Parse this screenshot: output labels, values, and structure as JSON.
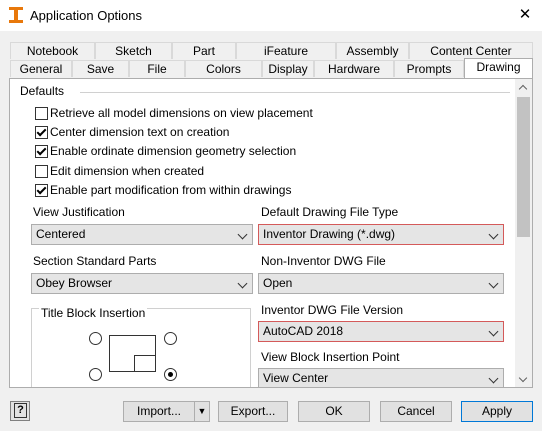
{
  "window": {
    "title": "Application Options",
    "close_glyph": "✕"
  },
  "tabs_row1": [
    {
      "label": "Notebook"
    },
    {
      "label": "Sketch"
    },
    {
      "label": "Part"
    },
    {
      "label": "iFeature"
    },
    {
      "label": "Assembly"
    },
    {
      "label": "Content Center"
    }
  ],
  "tabs_row2": [
    {
      "label": "General"
    },
    {
      "label": "Save"
    },
    {
      "label": "File"
    },
    {
      "label": "Colors"
    },
    {
      "label": "Display"
    },
    {
      "label": "Hardware"
    },
    {
      "label": "Prompts"
    },
    {
      "label": "Drawing"
    }
  ],
  "active_tab": "Drawing",
  "defaults": {
    "title": "Defaults",
    "checkboxes": [
      {
        "label": "Retrieve all model dimensions on view placement",
        "checked": false
      },
      {
        "label": "Center dimension text on creation",
        "checked": true
      },
      {
        "label": "Enable ordinate dimension geometry selection",
        "checked": true
      },
      {
        "label": "Edit dimension when created",
        "checked": false
      },
      {
        "label": "Enable part modification from within drawings",
        "checked": true
      }
    ]
  },
  "view_justification": {
    "label": "View Justification",
    "value": "Centered"
  },
  "default_drawing_type": {
    "label": "Default Drawing File Type",
    "value": "Inventor Drawing (*.dwg)"
  },
  "section_standard_parts": {
    "label": "Section Standard Parts",
    "value": "Obey Browser"
  },
  "non_inventor_dwg": {
    "label": "Non-Inventor DWG File",
    "value": "Open"
  },
  "inventor_dwg_version": {
    "label": "Inventor DWG File Version",
    "value": "AutoCAD 2018"
  },
  "title_block": {
    "label": "Title Block Insertion"
  },
  "view_block_insertion": {
    "label": "View Block Insertion Point",
    "value": "View Center"
  },
  "buttons": {
    "help_glyph": "?",
    "import": "Import...",
    "import_arrow": "▼",
    "export": "Export...",
    "ok": "OK",
    "cancel": "Cancel",
    "apply": "Apply"
  },
  "colors": {
    "accent": "#0078d7",
    "error_border": "#d45a5a"
  }
}
